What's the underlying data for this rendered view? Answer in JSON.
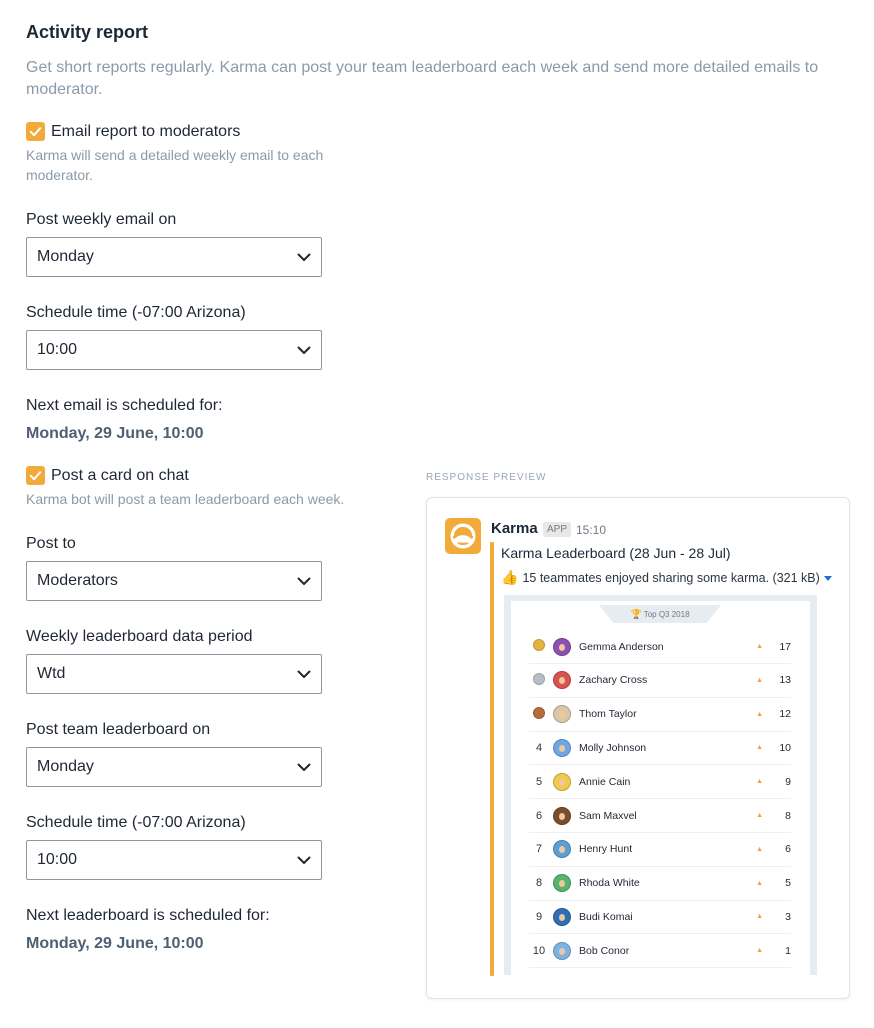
{
  "header": {
    "title": "Activity report",
    "description": "Get short reports regularly. Karma can post your team leaderboard each week and send more detailed emails to moderator."
  },
  "email_report": {
    "checkbox_label": "Email report to moderators",
    "checked": true,
    "hint": "Karma will send a detailed weekly email to each moderator.",
    "day_label": "Post weekly email on",
    "day_value": "Monday",
    "time_label": "Schedule time (-07:00 Arizona)",
    "time_value": "10:00",
    "next_label": "Next email is scheduled for:",
    "next_value": "Monday, 29 June, 10:00"
  },
  "chat_card": {
    "checkbox_label": "Post a card on chat",
    "checked": true,
    "hint": "Karma bot will post a team leaderboard each week.",
    "post_to_label": "Post to",
    "post_to_value": "Moderators",
    "period_label": "Weekly leaderboard data period",
    "period_value": "Wtd",
    "day_label": "Post team leaderboard on",
    "day_value": "Monday",
    "time_label": "Schedule time (-07:00 Arizona)",
    "time_value": "10:00",
    "next_label": "Next leaderboard is scheduled for:",
    "next_value": "Monday, 29 June, 10:00"
  },
  "preview": {
    "section_label": "RESPONSE PREVIEW",
    "bot_name": "Karma",
    "app_badge": "APP",
    "time": "15:10",
    "title": "Karma Leaderboard (28 Jun - 28 Jul)",
    "subtitle": "15 teammates enjoyed sharing some karma. (321 kB)",
    "board_tab": "Top Q3 2018",
    "rows": [
      {
        "rank": "",
        "medal": "#e3b341",
        "avatar": "#8e4fb3",
        "name": "Gemma Anderson",
        "score": "17"
      },
      {
        "rank": "",
        "medal": "#b8bec7",
        "avatar": "#d9534f",
        "name": "Zachary Cross",
        "score": "13"
      },
      {
        "rank": "",
        "medal": "#b86b3a",
        "avatar": "#d8c7a8",
        "name": "Thom Taylor",
        "score": "12"
      },
      {
        "rank": "4",
        "medal": "",
        "avatar": "#6fa6e8",
        "name": "Molly Johnson",
        "score": "10"
      },
      {
        "rank": "5",
        "medal": "",
        "avatar": "#f2c94c",
        "name": "Annie Cain",
        "score": "9"
      },
      {
        "rank": "6",
        "medal": "",
        "avatar": "#7a4e2d",
        "name": "Sam Maxvel",
        "score": "8"
      },
      {
        "rank": "7",
        "medal": "",
        "avatar": "#5aa0d6",
        "name": "Henry Hunt",
        "score": "6"
      },
      {
        "rank": "8",
        "medal": "",
        "avatar": "#57b36d",
        "name": "Rhoda White",
        "score": "5"
      },
      {
        "rank": "9",
        "medal": "",
        "avatar": "#2f6fb3",
        "name": "Budi Komai",
        "score": "3"
      },
      {
        "rank": "10",
        "medal": "",
        "avatar": "#7db3e3",
        "name": "Bob Conor",
        "score": "1"
      }
    ]
  }
}
